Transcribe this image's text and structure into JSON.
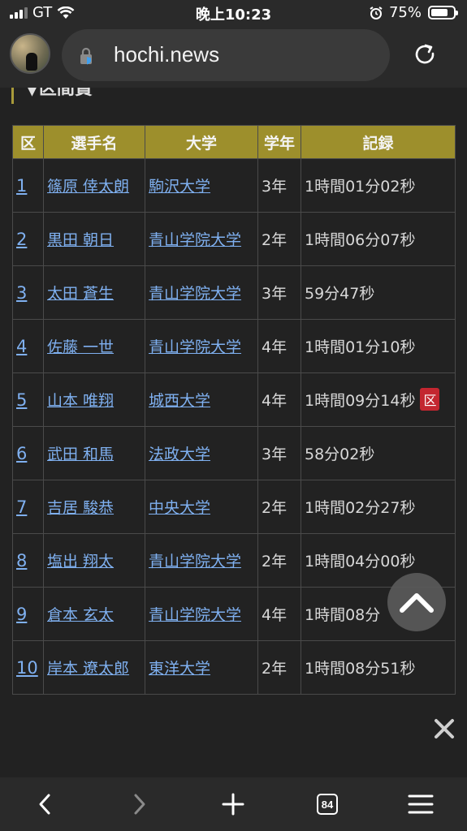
{
  "status_bar": {
    "carrier": "GT",
    "time": "晚上10:23",
    "battery": "75%",
    "battery_level": 0.75
  },
  "browser": {
    "url": "hochi.news",
    "tabs_count": "84"
  },
  "page": {
    "section_title": "▼区間賞",
    "table": {
      "headers": [
        "区",
        "選手名",
        "大学",
        "学年",
        "記録"
      ],
      "rows": [
        {
          "rank": "1",
          "name": "篠原 倖太朗",
          "university": "駒沢大学",
          "year": "3年",
          "record": "1時間01分02秒",
          "badge": ""
        },
        {
          "rank": "2",
          "name": "黒田 朝日",
          "university": "青山学院大学",
          "year": "2年",
          "record": "1時間06分07秒",
          "badge": ""
        },
        {
          "rank": "3",
          "name": "太田 蒼生",
          "university": "青山学院大学",
          "year": "3年",
          "record": "59分47秒",
          "badge": ""
        },
        {
          "rank": "4",
          "name": "佐藤 一世",
          "university": "青山学院大学",
          "year": "4年",
          "record": "1時間01分10秒",
          "badge": ""
        },
        {
          "rank": "5",
          "name": "山本 唯翔",
          "university": "城西大学",
          "year": "4年",
          "record": "1時間09分14秒",
          "badge": "区"
        },
        {
          "rank": "6",
          "name": "武田 和馬",
          "university": "法政大学",
          "year": "3年",
          "record": "58分02秒",
          "badge": ""
        },
        {
          "rank": "7",
          "name": "吉居 駿恭",
          "university": "中央大学",
          "year": "2年",
          "record": "1時間02分27秒",
          "badge": ""
        },
        {
          "rank": "8",
          "name": "塩出 翔太",
          "university": "青山学院大学",
          "year": "2年",
          "record": "1時間04分00秒",
          "badge": ""
        },
        {
          "rank": "9",
          "name": "倉本 玄太",
          "university": "青山学院大学",
          "year": "4年",
          "record": "1時間08分",
          "badge": ""
        },
        {
          "rank": "10",
          "name": "岸本 遼太郎",
          "university": "東洋大学",
          "year": "2年",
          "record": "1時間08分51秒",
          "badge": ""
        }
      ]
    }
  },
  "icons": {
    "back": "chevron-left-icon",
    "forward": "chevron-right-icon",
    "new_tab": "plus-icon",
    "tabs": "tabs-icon",
    "menu": "hamburger-menu-icon",
    "reload": "reload-icon",
    "scroll_top": "chevron-up-icon",
    "close": "close-icon"
  },
  "colors": {
    "header_bg": "#9d8f2c",
    "link": "#7fb0f0",
    "badge": "#c32630",
    "page_bg": "#222222"
  }
}
